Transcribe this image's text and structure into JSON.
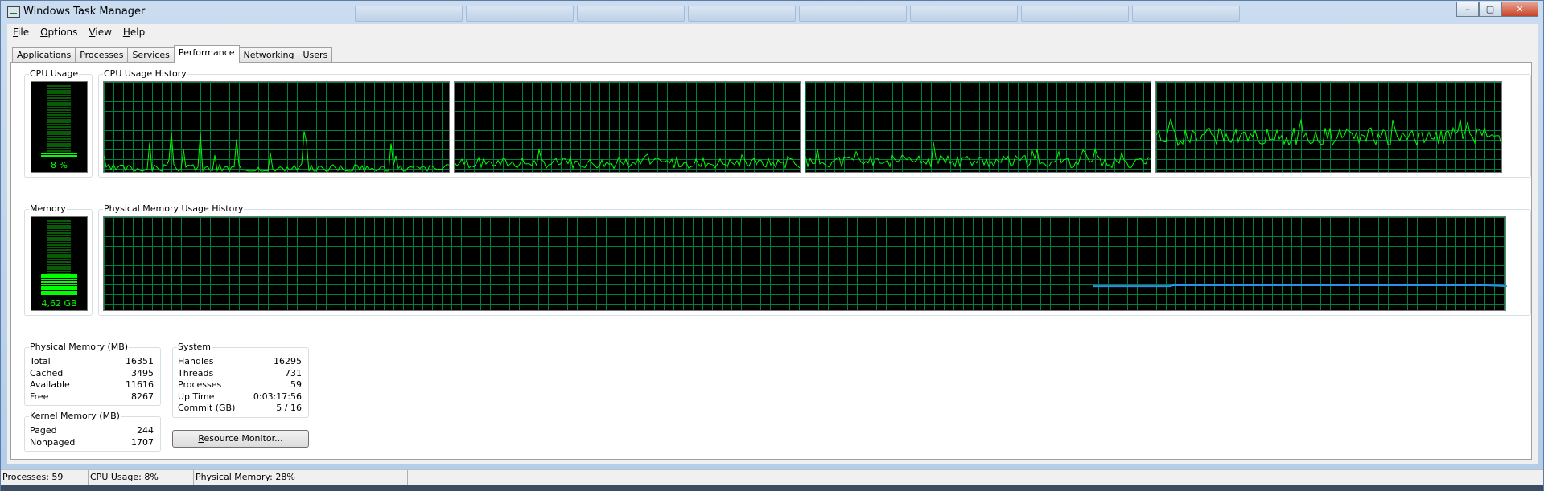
{
  "window": {
    "title": "Windows Task Manager",
    "min_glyph": "–",
    "max_glyph": "▢",
    "close_glyph": "✕"
  },
  "menu": [
    {
      "mnemonic": "F",
      "rest": "ile"
    },
    {
      "mnemonic": "O",
      "rest": "ptions"
    },
    {
      "mnemonic": "V",
      "rest": "iew"
    },
    {
      "mnemonic": "H",
      "rest": "elp"
    }
  ],
  "tabs": [
    "Applications",
    "Processes",
    "Services",
    "Performance",
    "Networking",
    "Users"
  ],
  "active_tab": "Performance",
  "cpu": {
    "label": "CPU Usage",
    "value_text": "8 %",
    "level": 0.08,
    "history_label": "CPU Usage History",
    "cores": [
      {
        "baseline": 0.04,
        "spike_max": 0.45,
        "noise": 0.05,
        "seed": 3
      },
      {
        "baseline": 0.1,
        "spike_max": 0.12,
        "noise": 0.06,
        "seed": 7
      },
      {
        "baseline": 0.12,
        "spike_max": 0.18,
        "noise": 0.07,
        "seed": 11
      },
      {
        "baseline": 0.4,
        "spike_max": 0.25,
        "noise": 0.1,
        "seed": 19
      }
    ]
  },
  "memory": {
    "label": "Memory",
    "value_text": "4,62 GB",
    "level": 0.28,
    "history_label": "Physical Memory Usage History",
    "history": [
      {
        "t": 0.705,
        "v": 0.27
      },
      {
        "t": 0.76,
        "v": 0.27
      },
      {
        "t": 0.762,
        "v": 0.28
      },
      {
        "t": 0.985,
        "v": 0.28
      },
      {
        "t": 1.0,
        "v": 0.27
      }
    ]
  },
  "physical_memory": {
    "title": "Physical Memory (MB)",
    "rows": [
      {
        "label": "Total",
        "value": "16351"
      },
      {
        "label": "Cached",
        "value": "3495"
      },
      {
        "label": "Available",
        "value": "11616"
      },
      {
        "label": "Free",
        "value": "8267"
      }
    ]
  },
  "kernel_memory": {
    "title": "Kernel Memory (MB)",
    "rows": [
      {
        "label": "Paged",
        "value": "244"
      },
      {
        "label": "Nonpaged",
        "value": "1707"
      }
    ]
  },
  "system": {
    "title": "System",
    "rows": [
      {
        "label": "Handles",
        "value": "16295"
      },
      {
        "label": "Threads",
        "value": "731"
      },
      {
        "label": "Processes",
        "value": "59"
      },
      {
        "label": "Up Time",
        "value": "0:03:17:56"
      },
      {
        "label": "Commit (GB)",
        "value": "5 / 16"
      }
    ]
  },
  "resource_monitor_button": {
    "mnemonic": "R",
    "rest": "esource Monitor..."
  },
  "statusbar": {
    "processes": "Processes: 59",
    "cpu": "CPU Usage: 8%",
    "memory": "Physical Memory: 28%"
  },
  "colors": {
    "graph_line": "#00ff00",
    "memory_line": "#2e8ff0",
    "grid": "#008040"
  }
}
